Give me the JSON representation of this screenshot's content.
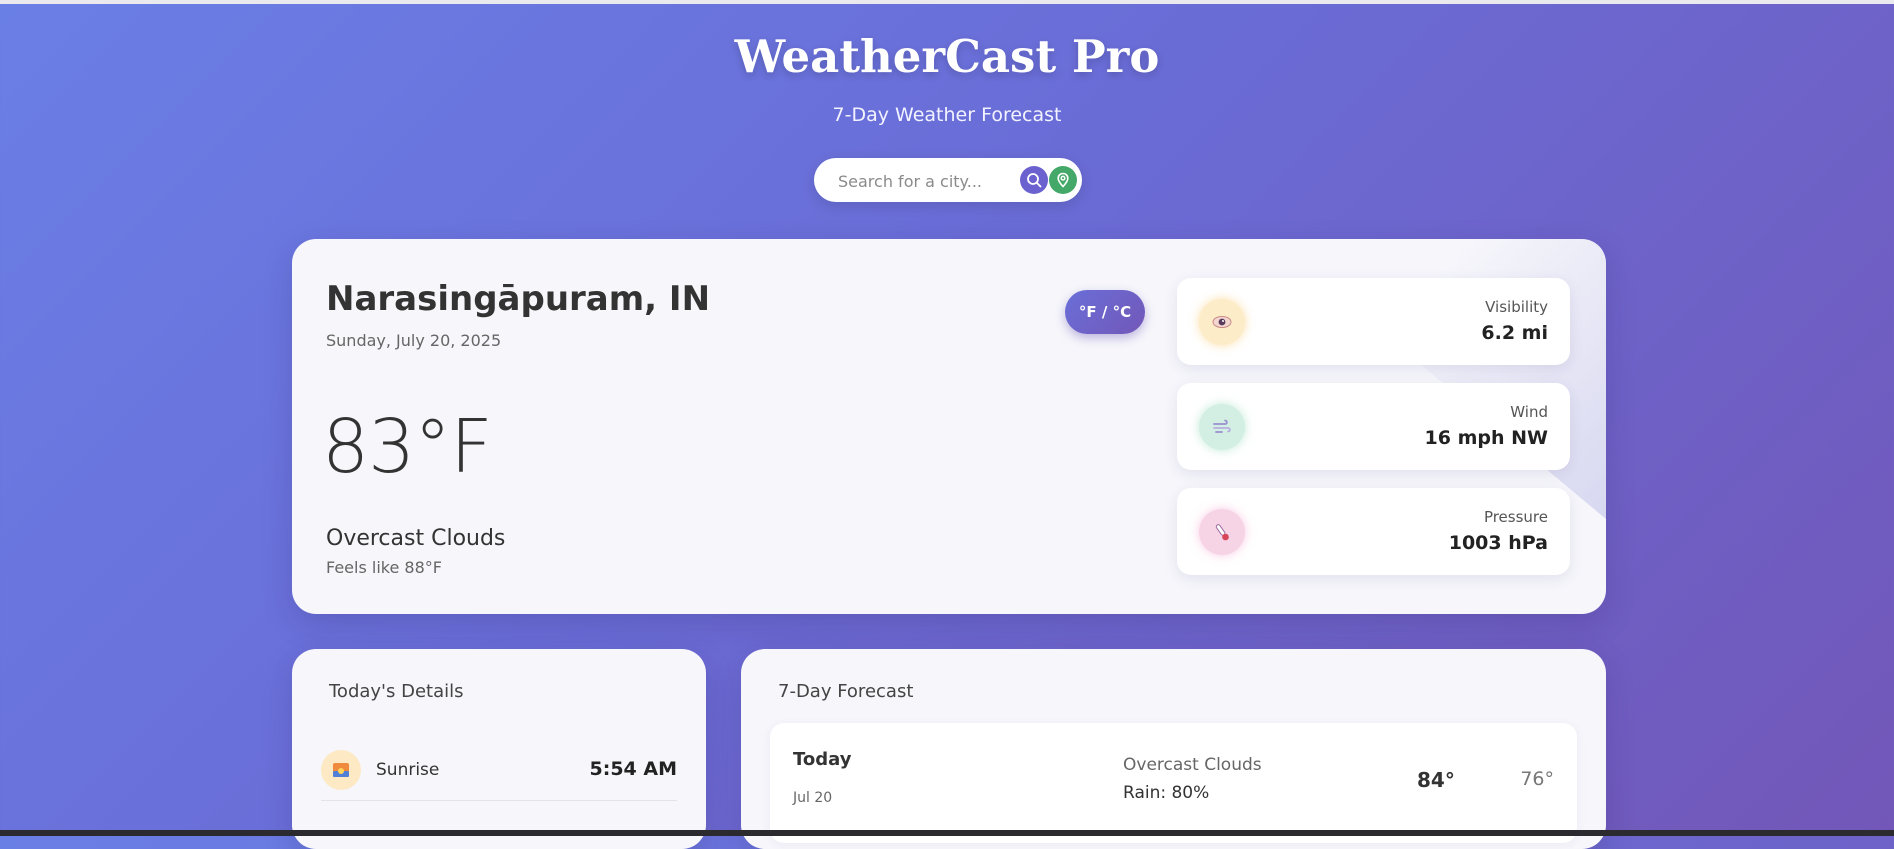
{
  "header": {
    "title": "WeatherCast Pro",
    "subtitle": "7-Day Weather Forecast"
  },
  "search": {
    "placeholder": "Search for a city...",
    "search_icon": "search-icon",
    "location_icon": "location-pin-icon"
  },
  "current": {
    "city": "Narasingāpuram, IN",
    "date": "Sunday, July 20, 2025",
    "temperature": "83°F",
    "condition": "Overcast Clouds",
    "feels_like": "Feels like 88°F",
    "unit_toggle": "°F / °C",
    "stats": [
      {
        "label": "Visibility",
        "value": "6.2 mi",
        "icon": "eye-icon"
      },
      {
        "label": "Wind",
        "value": "16 mph NW",
        "icon": "wind-icon"
      },
      {
        "label": "Pressure",
        "value": "1003 hPa",
        "icon": "thermometer-icon"
      }
    ]
  },
  "details": {
    "title": "Today's Details",
    "items": [
      {
        "label": "Sunrise",
        "value": "5:54 AM",
        "icon": "sunrise-icon"
      }
    ]
  },
  "forecast": {
    "title": "7-Day Forecast",
    "days": [
      {
        "day": "Today",
        "date": "Jul 20",
        "condition": "Overcast Clouds",
        "rain": "Rain: 80%",
        "high": "84°",
        "low": "76°"
      }
    ]
  },
  "colors": {
    "background_start": "#6a7fe6",
    "background_end": "#7257b8",
    "search_button": "#6b62cf",
    "location_button": "#44a868"
  }
}
